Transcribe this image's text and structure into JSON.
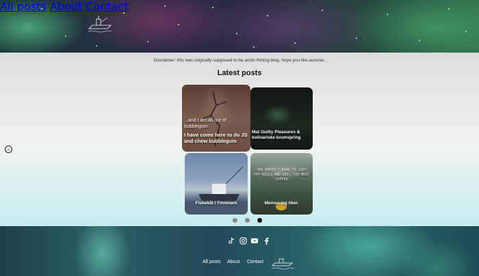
{
  "header": {
    "nav": [
      {
        "label": "All posts"
      },
      {
        "label": "About"
      },
      {
        "label": "Contact"
      }
    ]
  },
  "main": {
    "disclaimer": "Disclaimer: this was originally supposed to be arctic fishing blog, hope you like auroras.",
    "heading": "Latest posts",
    "posts": [
      {
        "subtitle": "...and I am all out of bubblegum",
        "title": "I have come here to do JS and chew bubblegum"
      },
      {
        "title": "Mat Guilty Pleasures & kulinariske krumspring"
      },
      {
        "title": "Fiskebåt i Finnmark"
      },
      {
        "title": "Memes jeg liker.",
        "image_text": "YOU WEREN'T BORN TO JUST PAY BILLS AND DIE. YOU MUST SUFFER"
      }
    ],
    "carousel": {
      "pages": 3,
      "active": 3
    }
  },
  "footer": {
    "social": [
      "tiktok-icon",
      "instagram-icon",
      "youtube-icon",
      "facebook-icon"
    ],
    "nav": [
      {
        "label": "All posts"
      },
      {
        "label": "About"
      },
      {
        "label": "Contact"
      }
    ]
  }
}
